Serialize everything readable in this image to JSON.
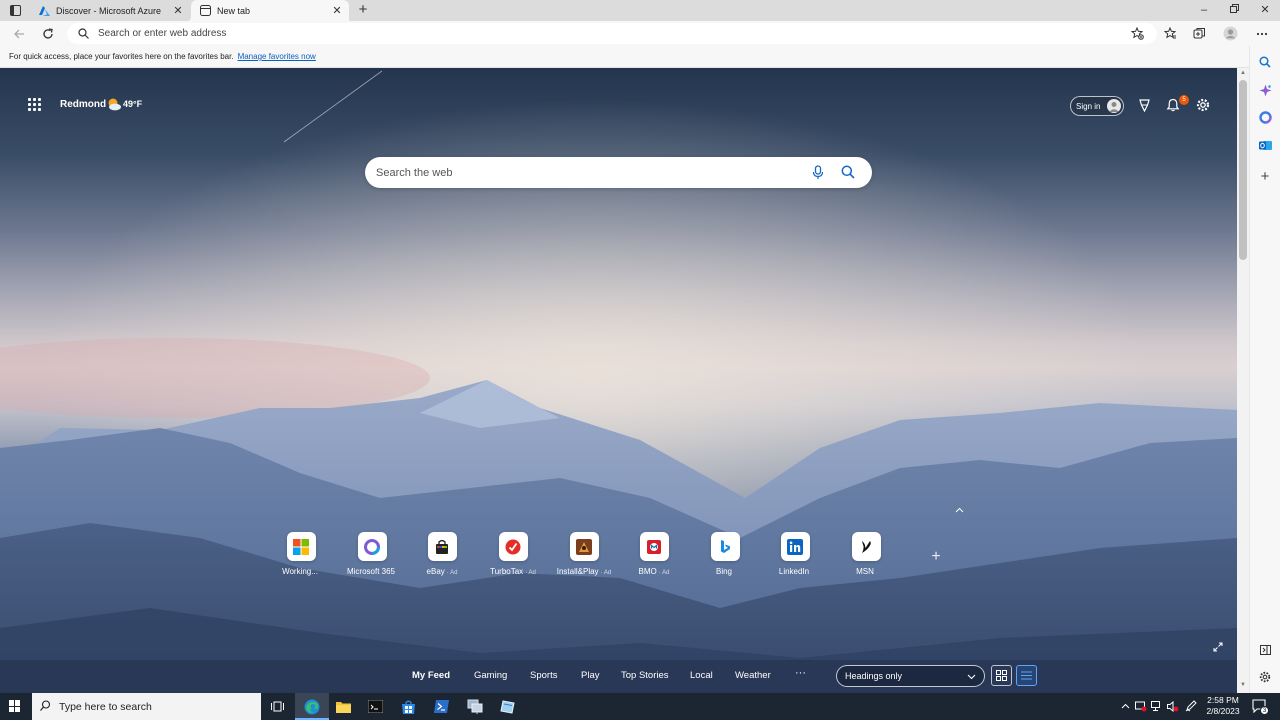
{
  "browser": {
    "tabs": [
      {
        "title": "Discover - Microsoft Azure",
        "favicon": "azure-icon",
        "active": false
      },
      {
        "title": "New tab",
        "favicon": "newtab-page-icon",
        "active": true
      }
    ],
    "address_placeholder": "Search or enter web address",
    "favorites_bar": {
      "message": "For quick access, place your favorites here on the favorites bar.",
      "link": "Manage favorites now"
    }
  },
  "newtab": {
    "location": "Redmond",
    "temperature": "49°F",
    "sign_in": "Sign in",
    "notifications_count": "5",
    "search_placeholder": "Search the web",
    "quick_links": [
      {
        "label": "Working...",
        "ad": "",
        "icon": "microsoft-logo-icon"
      },
      {
        "label": "Microsoft 365",
        "ad": "",
        "icon": "microsoft-365-icon"
      },
      {
        "label": "eBay",
        "ad": "· Ad",
        "icon": "ebay-bag-icon"
      },
      {
        "label": "TurboTax",
        "ad": "· Ad",
        "icon": "turbotax-check-icon"
      },
      {
        "label": "Install&Play",
        "ad": "· Ad",
        "icon": "game-icon"
      },
      {
        "label": "BMO",
        "ad": "· Ad",
        "icon": "bmo-icon"
      },
      {
        "label": "Bing",
        "ad": "",
        "icon": "bing-icon"
      },
      {
        "label": "LinkedIn",
        "ad": "",
        "icon": "linkedin-icon"
      },
      {
        "label": "MSN",
        "ad": "",
        "icon": "msn-icon"
      }
    ],
    "feed_tabs": [
      "My Feed",
      "Gaming",
      "Sports",
      "Play",
      "Top Stories",
      "Local",
      "Weather"
    ],
    "feed_more": "···",
    "layout_select": "Headings only"
  },
  "taskbar": {
    "search_placeholder": "Type here to search",
    "time": "2:58 PM",
    "date": "2/8/2023",
    "notification_count": "3"
  },
  "colors": {
    "accent": "#0b5fc0",
    "taskbar": "#1c2532",
    "badge": "#e8590c"
  }
}
